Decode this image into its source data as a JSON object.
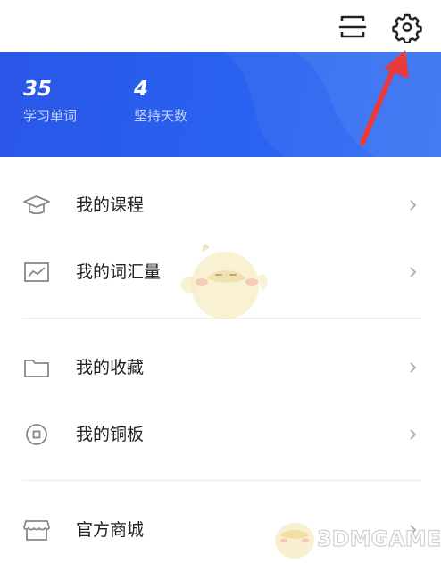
{
  "stats": [
    {
      "value": "35",
      "label": "学习单词"
    },
    {
      "value": "4",
      "label": "坚持天数"
    }
  ],
  "menu": {
    "courses": "我的课程",
    "vocabulary": "我的词汇量",
    "favorites": "我的收藏",
    "coins": "我的铜板",
    "store": "官方商城"
  },
  "watermark": "3DMGAME",
  "colors": {
    "banner": "#2962f0",
    "arrow": "#ea3b3b",
    "icon": "#888888"
  }
}
